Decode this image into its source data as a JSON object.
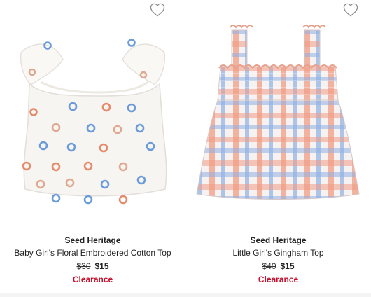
{
  "colors": {
    "clearance": "#c8102e",
    "heart_outline": "#9a9a9a"
  },
  "products": [
    {
      "brand": "Seed Heritage",
      "title": "Baby Girl's Floral Embroidered Cotton Top",
      "original_price": "$30",
      "sale_price": "$15",
      "badge": "Clearance",
      "wishlist_icon": "heart-outline-icon"
    },
    {
      "brand": "Seed Heritage",
      "title": "Little Girl's Gingham Top",
      "original_price": "$40",
      "sale_price": "$15",
      "badge": "Clearance",
      "wishlist_icon": "heart-outline-icon"
    }
  ]
}
